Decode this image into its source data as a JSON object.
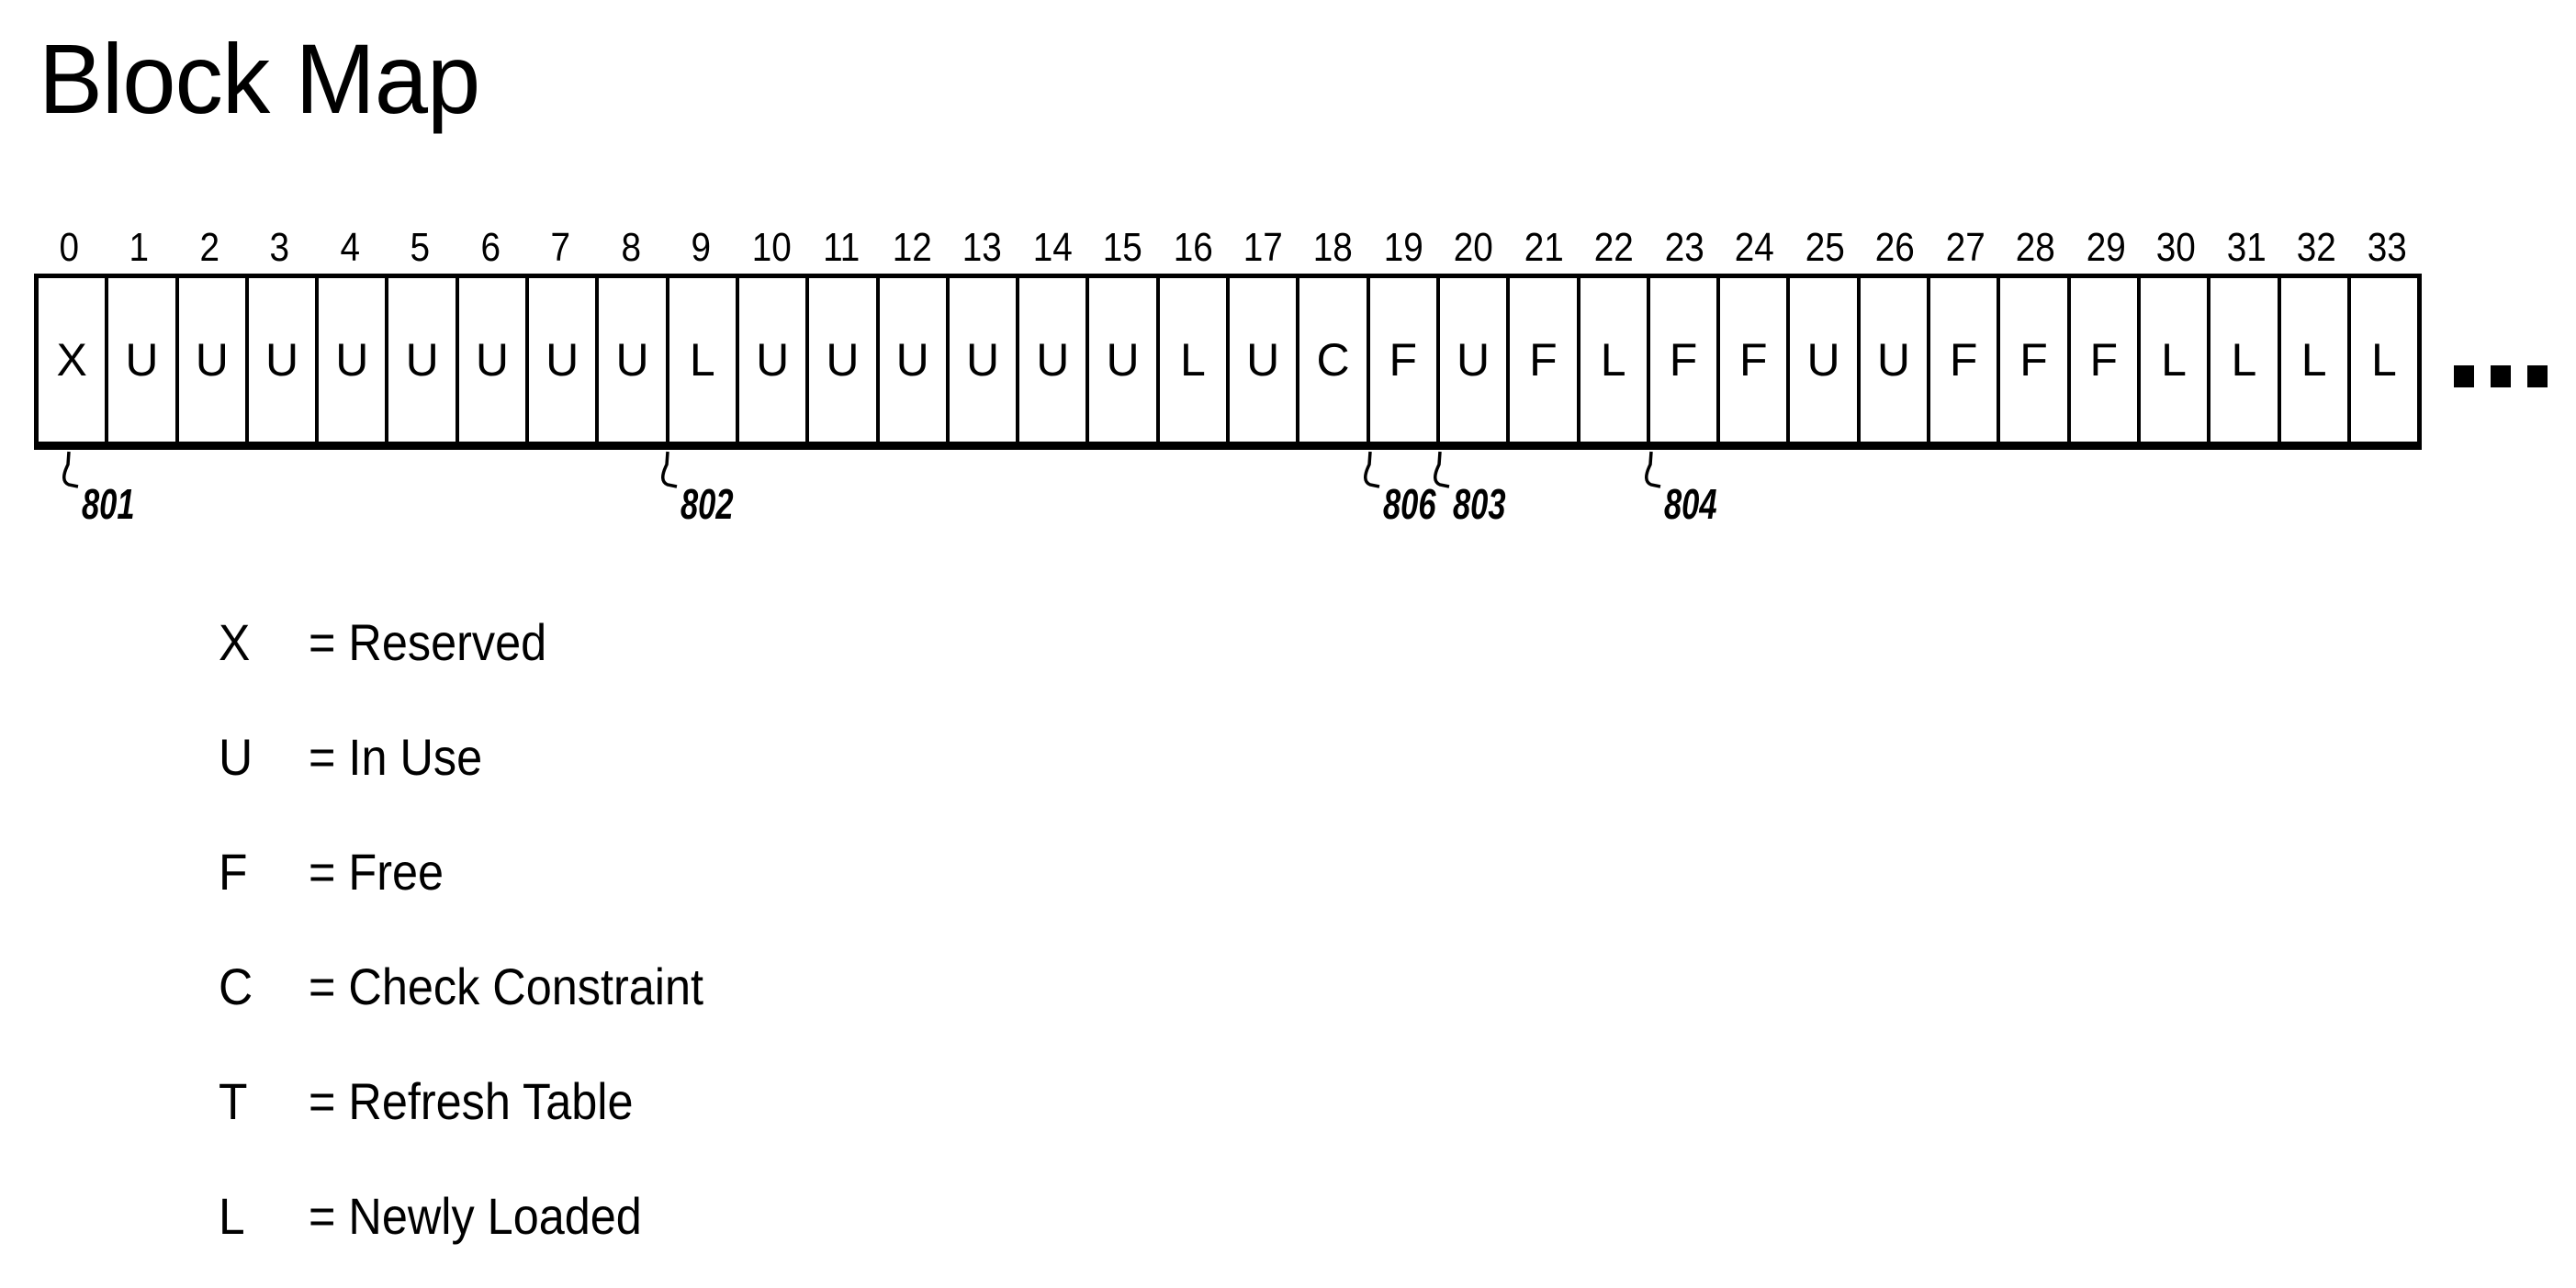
{
  "title": "Block Map",
  "blocks": [
    {
      "index": "0",
      "code": "X"
    },
    {
      "index": "1",
      "code": "U"
    },
    {
      "index": "2",
      "code": "U"
    },
    {
      "index": "3",
      "code": "U"
    },
    {
      "index": "4",
      "code": "U"
    },
    {
      "index": "5",
      "code": "U"
    },
    {
      "index": "6",
      "code": "U"
    },
    {
      "index": "7",
      "code": "U"
    },
    {
      "index": "8",
      "code": "U"
    },
    {
      "index": "9",
      "code": "L"
    },
    {
      "index": "10",
      "code": "U"
    },
    {
      "index": "11",
      "code": "U"
    },
    {
      "index": "12",
      "code": "U"
    },
    {
      "index": "13",
      "code": "U"
    },
    {
      "index": "14",
      "code": "U"
    },
    {
      "index": "15",
      "code": "U"
    },
    {
      "index": "16",
      "code": "L"
    },
    {
      "index": "17",
      "code": "U"
    },
    {
      "index": "18",
      "code": "C"
    },
    {
      "index": "19",
      "code": "F"
    },
    {
      "index": "20",
      "code": "U"
    },
    {
      "index": "21",
      "code": "F"
    },
    {
      "index": "22",
      "code": "L"
    },
    {
      "index": "23",
      "code": "F"
    },
    {
      "index": "24",
      "code": "F"
    },
    {
      "index": "25",
      "code": "U"
    },
    {
      "index": "26",
      "code": "U"
    },
    {
      "index": "27",
      "code": "F"
    },
    {
      "index": "28",
      "code": "F"
    },
    {
      "index": "29",
      "code": "F"
    },
    {
      "index": "30",
      "code": "L"
    },
    {
      "index": "31",
      "code": "L"
    },
    {
      "index": "32",
      "code": "L"
    },
    {
      "index": "33",
      "code": "L"
    }
  ],
  "continuation": "more-blocks-ellipsis",
  "callouts": [
    {
      "label": "801",
      "block": 0
    },
    {
      "label": "802",
      "block": 8
    },
    {
      "label": "806",
      "block": 18
    },
    {
      "label": "803",
      "block": 19
    },
    {
      "label": "804",
      "block": 22
    }
  ],
  "legend": [
    {
      "symbol": "X",
      "description": "= Reserved"
    },
    {
      "symbol": "U",
      "description": "= In Use"
    },
    {
      "symbol": "F",
      "description": "= Free"
    },
    {
      "symbol": "C",
      "description": "= Check Constraint"
    },
    {
      "symbol": "T",
      "description": "= Refresh Table"
    },
    {
      "symbol": "L",
      "description": "= Newly Loaded"
    }
  ]
}
